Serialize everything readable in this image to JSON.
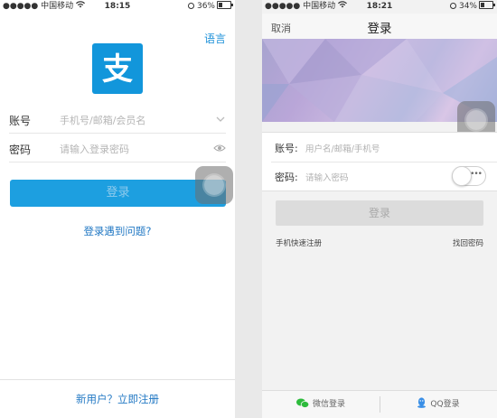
{
  "left_phone": {
    "status": {
      "carrier": "中国移动",
      "time": "18:15",
      "battery": "36%",
      "battery_fill": 0.36
    },
    "language_link": "语言",
    "logo_glyph": "支",
    "account_label": "账号",
    "account_placeholder": "手机号/邮箱/会员名",
    "password_label": "密码",
    "password_placeholder": "请输入登录密码",
    "login_button": "登录",
    "problem_link": "登录遇到问题?",
    "register_link": "新用户？立即注册",
    "colors": {
      "brand": "#1296db",
      "button": "#1d9fe0",
      "link": "#2379c4"
    }
  },
  "right_phone": {
    "status": {
      "carrier": "中国移动",
      "time": "18:21",
      "battery": "34%",
      "battery_fill": 0.34
    },
    "nav": {
      "cancel": "取消",
      "title": "登录"
    },
    "account_label": "账号:",
    "account_placeholder": "用户名/邮箱/手机号",
    "password_label": "密码:",
    "password_placeholder": "请输入密码",
    "toggle_dots": "•••",
    "login_button": "登录",
    "quick_register": "手机快速注册",
    "forgot_password": "找回密码",
    "bottom": {
      "wechat": "微信登录",
      "qq": "QQ登录"
    },
    "colors": {
      "wechat": "#2dbb3c",
      "qq": "#3a8fe6",
      "button_disabled": "#dcdcdc"
    }
  },
  "icons": [
    "wifi-icon",
    "alarm-icon",
    "battery-icon",
    "chevron-down-icon",
    "eye-icon",
    "assistive-touch-icon",
    "wechat-icon",
    "qq-icon"
  ]
}
